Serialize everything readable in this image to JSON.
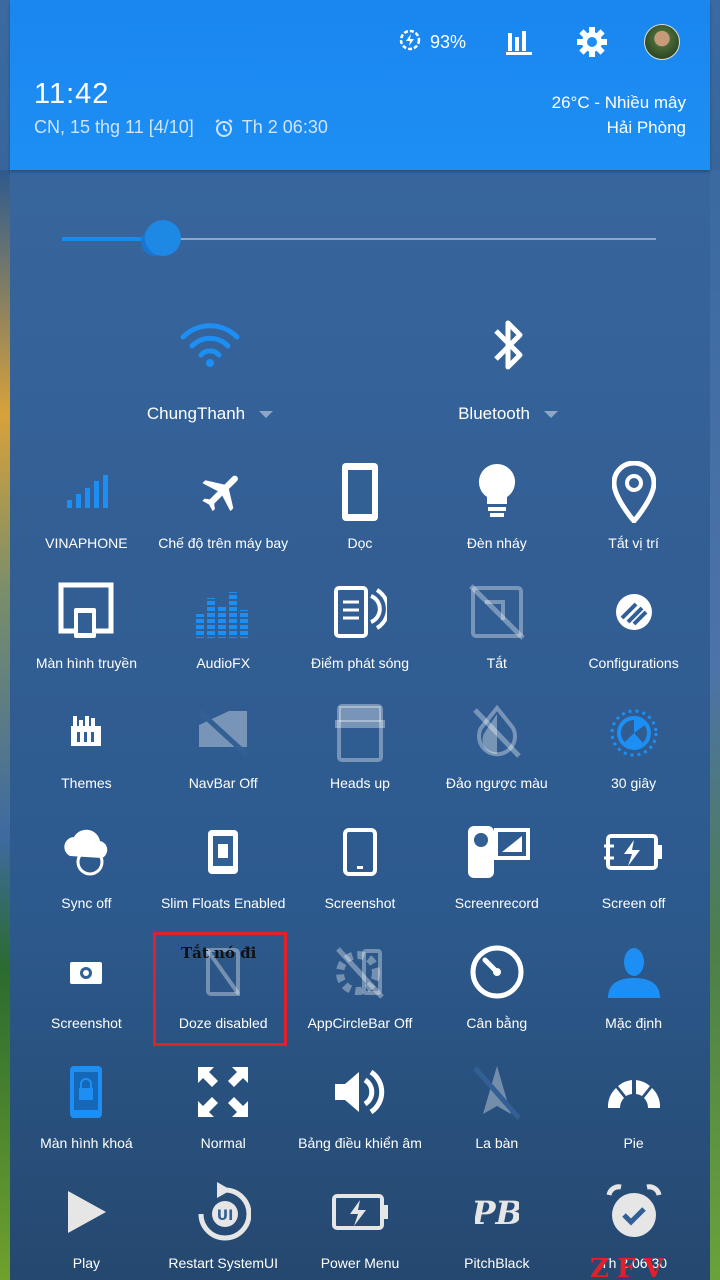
{
  "status": {
    "battery": "93%"
  },
  "header": {
    "time": "11:42",
    "date": "CN, 15 thg 11 [4/10]",
    "alarm": "Th 2 06:30",
    "weather_line1": "26°C - Nhiều mây",
    "weather_line2": "Hải Phòng"
  },
  "brightness": {
    "level": 0.17
  },
  "wifi": {
    "label": "ChungThanh"
  },
  "bluetooth": {
    "label": "Bluetooth"
  },
  "tiles": [
    {
      "label": "VINAPHONE",
      "icon": "signal-icon"
    },
    {
      "label": "Chế độ trên máy bay",
      "icon": "airplane-icon"
    },
    {
      "label": "Dọc",
      "icon": "portrait-icon"
    },
    {
      "label": "Đèn nháy",
      "icon": "bulb-icon"
    },
    {
      "label": "Tắt vị trí",
      "icon": "location-icon"
    },
    {
      "label": "Màn hình truyền",
      "icon": "cast-icon"
    },
    {
      "label": "AudioFX",
      "icon": "equalizer-icon"
    },
    {
      "label": "Điểm phát sóng",
      "icon": "hotspot-icon"
    },
    {
      "label": "Tắt",
      "icon": "nfc-off-icon"
    },
    {
      "label": "Configurations",
      "icon": "config-icon"
    },
    {
      "label": "Themes",
      "icon": "themes-icon"
    },
    {
      "label": "NavBar Off",
      "icon": "navbar-off-icon"
    },
    {
      "label": "Heads up",
      "icon": "heads-up-icon"
    },
    {
      "label": "Đảo ngược màu",
      "icon": "invert-colors-icon"
    },
    {
      "label": "30 giây",
      "icon": "timeout-icon"
    },
    {
      "label": "Sync off",
      "icon": "sync-icon"
    },
    {
      "label": "Slim Floats Enabled",
      "icon": "floats-icon"
    },
    {
      "label": "Screenshot",
      "icon": "phone-icon"
    },
    {
      "label": "Screenrecord",
      "icon": "screenrecord-icon"
    },
    {
      "label": "Screen off",
      "icon": "battery-charge-icon"
    },
    {
      "label": "Screenshot",
      "icon": "camera-icon"
    },
    {
      "label": "Doze disabled",
      "icon": "doze-off-icon"
    },
    {
      "label": "AppCircleBar Off",
      "icon": "appcircle-off-icon"
    },
    {
      "label": "Cân bằng",
      "icon": "gauge-icon"
    },
    {
      "label": "Mặc định",
      "icon": "person-icon"
    },
    {
      "label": "Màn hình khoá",
      "icon": "lock-screen-icon"
    },
    {
      "label": "Normal",
      "icon": "expand-icon"
    },
    {
      "label": "Bảng điều khiển âm",
      "icon": "volume-icon"
    },
    {
      "label": "La bàn",
      "icon": "compass-off-icon"
    },
    {
      "label": "Pie",
      "icon": "pie-icon"
    },
    {
      "label": "Play",
      "icon": "play-icon"
    },
    {
      "label": "Restart SystemUI",
      "icon": "restart-ui-icon"
    },
    {
      "label": "Power Menu",
      "icon": "power-menu-icon"
    },
    {
      "label": "PitchBlack",
      "icon": "pitchblack-icon"
    },
    {
      "label": "Th 2 06:30",
      "icon": "alarm-clock-icon"
    }
  ],
  "annotation": {
    "text": "Tắt nó đi"
  },
  "watermark": {
    "text": "ZFV"
  }
}
